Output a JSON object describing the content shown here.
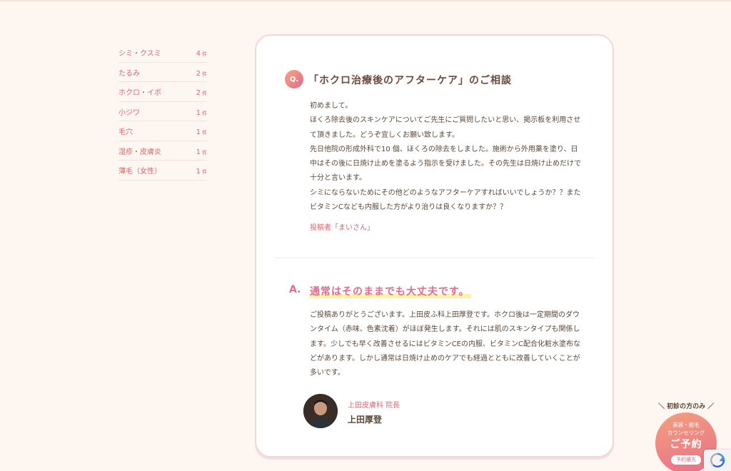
{
  "sidebar": {
    "categories": [
      {
        "label": "シミ・クスミ",
        "count": "4",
        "unit": "件"
      },
      {
        "label": "たるみ",
        "count": "2",
        "unit": "件"
      },
      {
        "label": "ホクロ・イボ",
        "count": "2",
        "unit": "件"
      },
      {
        "label": "小ジワ",
        "count": "1",
        "unit": "件"
      },
      {
        "label": "毛穴",
        "count": "1",
        "unit": "件"
      },
      {
        "label": "湿疹・皮膚炎",
        "count": "1",
        "unit": "件"
      },
      {
        "label": "薄毛（女性）",
        "count": "1",
        "unit": "件"
      }
    ]
  },
  "question": {
    "badge": "Q.",
    "title": "「ホクロ治療後のアフターケア」のご相談",
    "body": [
      "初めまして。",
      "ほくろ除去後のスキンケアについてご先生にご質問したいと思い、掲示板を利用させて頂きました。どうぞ宜しくお願い致します。",
      "先日他院の形成外科で10 個、ほくろの除去をしました。施術から外用薬を塗り、日中はその後に日焼け止めを塗るよう指示を受けました。その先生は日焼け止めだけで十分と言います。",
      "シミにならないためにその他どのようなアフターケアすればいいでしょうか？？またビタミンCなども内服した方がより治りは良くなりますか？？"
    ],
    "poster": "投稿者「まいさん」"
  },
  "answer": {
    "mark": "A.",
    "title": "通常はそのままでも大丈夫です。",
    "body": "ご投稿ありがとうございます。上田皮ふ科上田厚登です。ホクロ後は一定期間のダウンタイム（赤味、色素沈着）がほぼ発生します。それには肌のスキンタイプも関係します。少しでも早く改善させるにはビタミンCEの内服、ビタミンC配合化粧水塗布などがあります。しかし通常は日焼け止めのケアでも経過とともに改善していくことが多いです。",
    "doctor_role": "上田皮膚科 院長",
    "doctor_name": "上田厚登"
  },
  "reserve": {
    "ribbon": "初診の方のみ",
    "sub_line1": "美容・脱毛",
    "sub_line2": "カウンセリング",
    "main": "ご予約",
    "pill": "予約優先"
  },
  "colors": {
    "accent": "#e06a93",
    "category_text": "#d9666e",
    "background": "#fdf6f1"
  },
  "icons": [
    "doctor-avatar",
    "recaptcha-icon"
  ]
}
